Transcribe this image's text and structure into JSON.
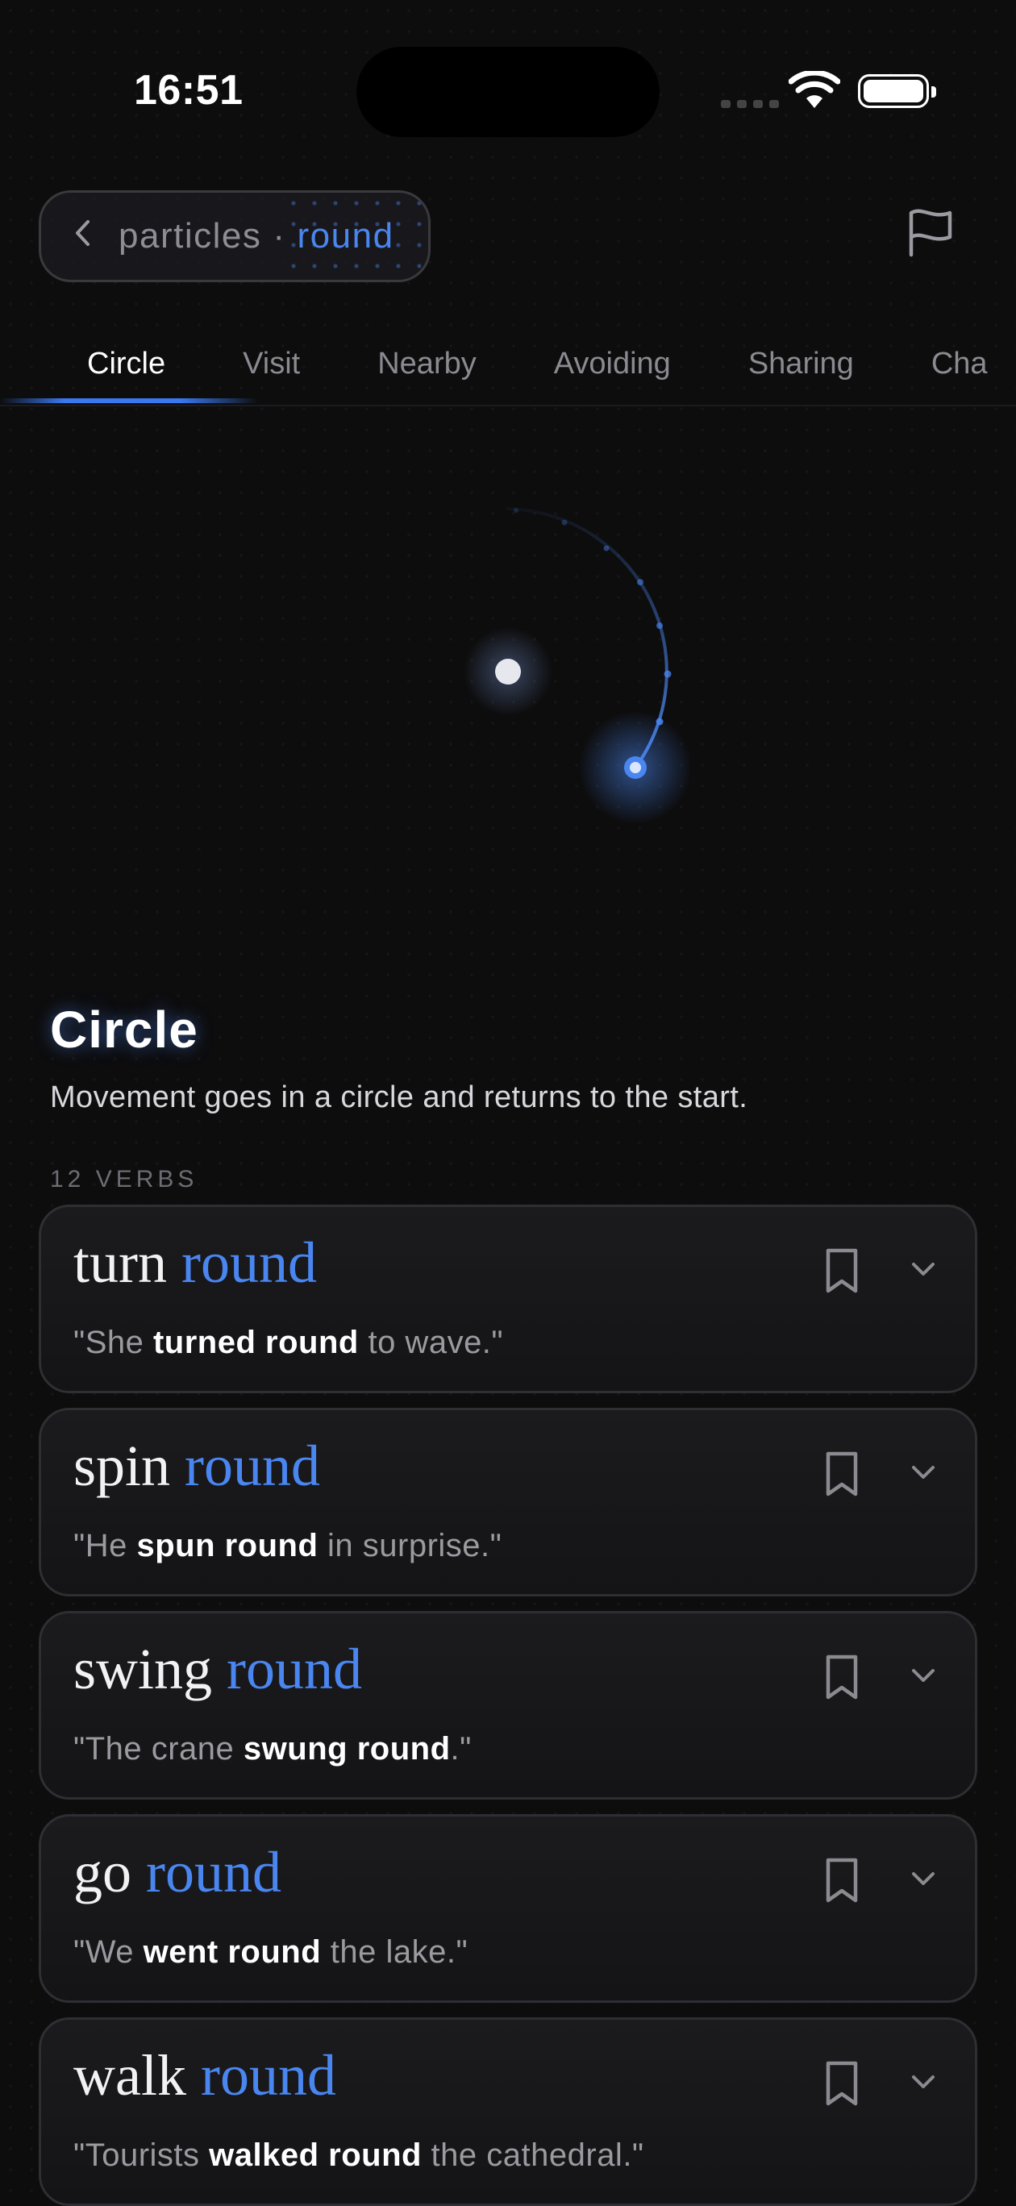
{
  "status_bar": {
    "time": "16:51"
  },
  "breadcrumb": {
    "back_icon": "chevron-left-icon",
    "parent": "particles",
    "separator": "·",
    "current": "round"
  },
  "header": {
    "flag_icon": "flag-icon"
  },
  "tabs": [
    {
      "label": "Circle",
      "active": true
    },
    {
      "label": "Visit",
      "active": false
    },
    {
      "label": "Nearby",
      "active": false
    },
    {
      "label": "Avoiding",
      "active": false
    },
    {
      "label": "Sharing",
      "active": false
    },
    {
      "label": "Cha",
      "active": false
    }
  ],
  "meaning": {
    "title": "Circle",
    "description": "Movement goes in a circle and returns to the start.",
    "verb_count": "12 VERBS"
  },
  "colors": {
    "accent": "#4a86f0",
    "background": "#0d0d0e",
    "card": "#1a1a1d"
  },
  "verbs": [
    {
      "verb": "turn",
      "particle": "round",
      "example": [
        {
          "t": "\"She "
        },
        {
          "t": "turned round",
          "b": true
        },
        {
          "t": " to wave.\""
        }
      ]
    },
    {
      "verb": "spin",
      "particle": "round",
      "example": [
        {
          "t": "\"He "
        },
        {
          "t": "spun round",
          "b": true
        },
        {
          "t": " in surprise.\""
        }
      ]
    },
    {
      "verb": "swing",
      "particle": "round",
      "example": [
        {
          "t": "\"The crane "
        },
        {
          "t": "swung round",
          "b": true
        },
        {
          "t": ".\""
        }
      ]
    },
    {
      "verb": "go",
      "particle": "round",
      "example": [
        {
          "t": "\"We "
        },
        {
          "t": "went round",
          "b": true
        },
        {
          "t": " the lake.\""
        }
      ]
    },
    {
      "verb": "walk",
      "particle": "round",
      "example": [
        {
          "t": "\"Tourists "
        },
        {
          "t": "walked round",
          "b": true
        },
        {
          "t": " the cathedral.\""
        }
      ]
    }
  ]
}
